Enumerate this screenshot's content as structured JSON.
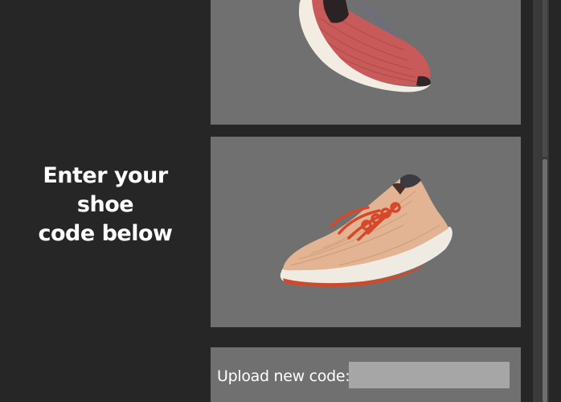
{
  "prompt": {
    "line1": "Enter your shoe",
    "line2": "code below"
  },
  "products": [
    {
      "icon": "red-running-shoe-image",
      "color": "#c95a5a"
    },
    {
      "icon": "peach-knit-sneaker-image",
      "color": "#e2b493"
    }
  ],
  "upload": {
    "label": "Upload new code:",
    "value": "",
    "placeholder": ""
  },
  "colors": {
    "background": "#262626",
    "card": "#707070",
    "input": "#a6a6a6",
    "text": "#ffffff"
  }
}
